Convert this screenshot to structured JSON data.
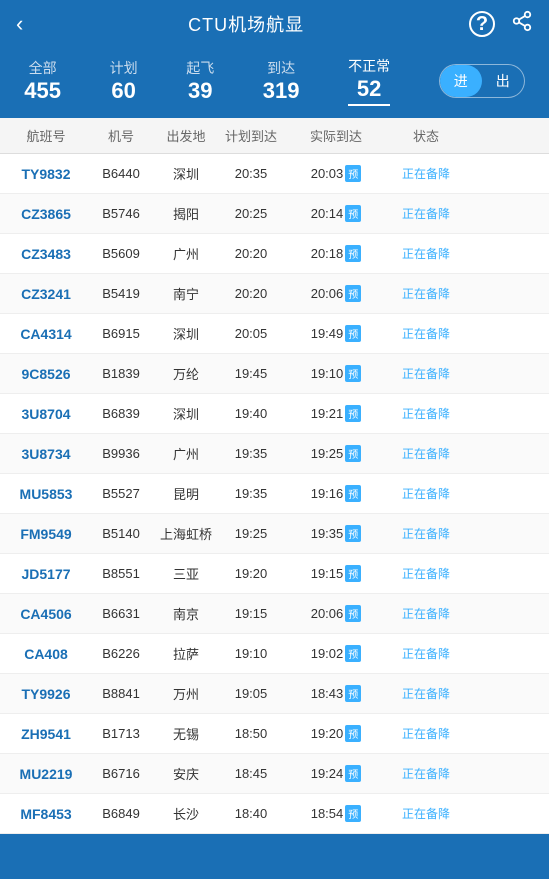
{
  "header": {
    "title": "CTU机场航显",
    "back_icon": "‹",
    "help_icon": "?",
    "share_icon": "⤴"
  },
  "stats": [
    {
      "label": "全部",
      "value": "455",
      "active": false
    },
    {
      "label": "计划",
      "value": "60",
      "active": false
    },
    {
      "label": "起飞",
      "value": "39",
      "active": false
    },
    {
      "label": "到达",
      "value": "319",
      "active": false
    },
    {
      "label": "不正常",
      "value": "52",
      "active": true
    }
  ],
  "toggle": {
    "options": [
      "进",
      "出"
    ],
    "active": 0
  },
  "table": {
    "columns": [
      "航班号",
      "机号",
      "出发地",
      "计划到达",
      "实际到达",
      "状态"
    ],
    "rows": [
      {
        "flight": "TY9832",
        "plane": "B6440",
        "origin": "深圳",
        "scheduled": "20:35",
        "actual": "20:03",
        "early": true,
        "status": "正在备降"
      },
      {
        "flight": "CZ3865",
        "plane": "B5746",
        "origin": "揭阳",
        "scheduled": "20:25",
        "actual": "20:14",
        "early": true,
        "status": "正在备降"
      },
      {
        "flight": "CZ3483",
        "plane": "B5609",
        "origin": "广州",
        "scheduled": "20:20",
        "actual": "20:18",
        "early": true,
        "status": "正在备降"
      },
      {
        "flight": "CZ3241",
        "plane": "B5419",
        "origin": "南宁",
        "scheduled": "20:20",
        "actual": "20:06",
        "early": true,
        "status": "正在备降"
      },
      {
        "flight": "CA4314",
        "plane": "B6915",
        "origin": "深圳",
        "scheduled": "20:05",
        "actual": "19:49",
        "early": true,
        "status": "正在备降"
      },
      {
        "flight": "9C8526",
        "plane": "B1839",
        "origin": "万纶",
        "scheduled": "19:45",
        "actual": "19:10",
        "early": true,
        "status": "正在备降"
      },
      {
        "flight": "3U8704",
        "plane": "B6839",
        "origin": "深圳",
        "scheduled": "19:40",
        "actual": "19:21",
        "early": true,
        "status": "正在备降"
      },
      {
        "flight": "3U8734",
        "plane": "B9936",
        "origin": "广州",
        "scheduled": "19:35",
        "actual": "19:25",
        "early": true,
        "status": "正在备降"
      },
      {
        "flight": "MU5853",
        "plane": "B5527",
        "origin": "昆明",
        "scheduled": "19:35",
        "actual": "19:16",
        "early": true,
        "status": "正在备降"
      },
      {
        "flight": "FM9549",
        "plane": "B5140",
        "origin": "上海虹桥",
        "scheduled": "19:25",
        "actual": "19:35",
        "early": true,
        "status": "正在备降"
      },
      {
        "flight": "JD5177",
        "plane": "B8551",
        "origin": "三亚",
        "scheduled": "19:20",
        "actual": "19:15",
        "early": true,
        "status": "正在备降"
      },
      {
        "flight": "CA4506",
        "plane": "B6631",
        "origin": "南京",
        "scheduled": "19:15",
        "actual": "20:06",
        "early": true,
        "status": "正在备降"
      },
      {
        "flight": "CA408",
        "plane": "B6226",
        "origin": "拉萨",
        "scheduled": "19:10",
        "actual": "19:02",
        "early": true,
        "status": "正在备降"
      },
      {
        "flight": "TY9926",
        "plane": "B8841",
        "origin": "万州",
        "scheduled": "19:05",
        "actual": "18:43",
        "early": true,
        "status": "正在备降"
      },
      {
        "flight": "ZH9541",
        "plane": "B1713",
        "origin": "无锡",
        "scheduled": "18:50",
        "actual": "19:20",
        "early": true,
        "status": "正在备降"
      },
      {
        "flight": "MU2219",
        "plane": "B6716",
        "origin": "安庆",
        "scheduled": "18:45",
        "actual": "19:24",
        "early": true,
        "status": "正在备降"
      },
      {
        "flight": "MF8453",
        "plane": "B6849",
        "origin": "长沙",
        "scheduled": "18:40",
        "actual": "18:54",
        "early": true,
        "status": "正在备降"
      }
    ]
  }
}
